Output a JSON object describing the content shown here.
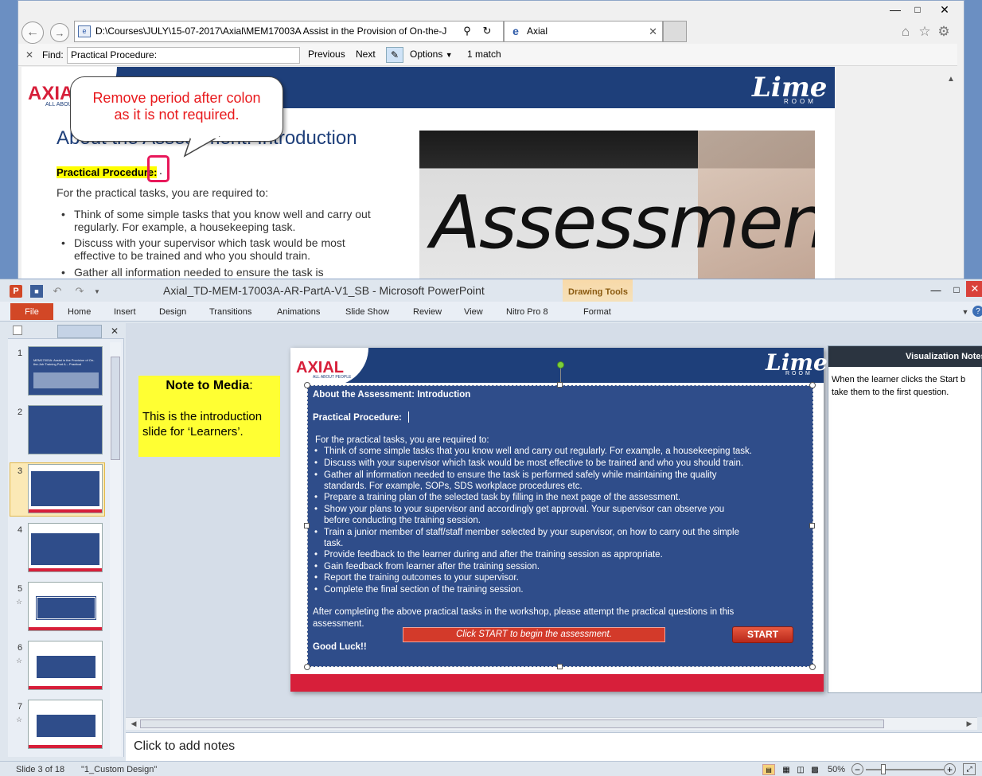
{
  "browser": {
    "address": "D:\\Courses\\JULY\\15-07-2017\\Axial\\MEM17003A Assist in the Provision of On-the-J",
    "tab_title": "Axial",
    "find_label": "Find:",
    "find_value": "Practical Procedure:",
    "previous": "Previous",
    "next": "Next",
    "options": "Options",
    "match_count": "1 match"
  },
  "web_page": {
    "logo": "AXIAL",
    "logo_sub": "ALL ABOUT",
    "brand": "Lime",
    "brand_sub": "ROOM",
    "heading": "About the Assessment: Introduction",
    "highlight": "Practical Procedure:",
    "period": ".",
    "intro": "For the practical tasks, you are required to:",
    "bullets": [
      "Think of some simple tasks that you know well and carry out regularly. For example, a housekeeping task.",
      "Discuss with your supervisor which task would be most effective to be trained and who you should train.",
      "Gather all information needed to ensure the task is"
    ],
    "image_text": "Assessment"
  },
  "callout": {
    "line1": "Remove period after colon",
    "line2": "as it is not required."
  },
  "ppt": {
    "title": "Axial_TD-MEM-17003A-AR-PartA-V1_SB  -  Microsoft PowerPoint",
    "context_tab_group": "Drawing Tools",
    "file_tab": "File",
    "tabs": [
      "Home",
      "Insert",
      "Design",
      "Transitions",
      "Animations",
      "Slide Show",
      "Review",
      "View",
      "Nitro Pro 8"
    ],
    "format_tab": "Format",
    "thumb_numbers": [
      "1",
      "2",
      "3",
      "4",
      "5",
      "6",
      "7"
    ],
    "thumb1_text": "MEM17003A: Assist in the Provision of On-the-Job Training Part A – Practical",
    "note_title": "Note to Media",
    "note_colon": ":",
    "note_body": "This is the introduction slide for ‘Learners’.",
    "notes_panel_title": "Visualization Notes",
    "notes_panel_body": "When the learner clicks the Start b take them to the first question.",
    "notes_placeholder": "Click to add notes",
    "status_slide": "Slide 3 of 18",
    "status_theme": "\"1_Custom Design\"",
    "zoom": "50%"
  },
  "slide": {
    "logo": "AXIAL",
    "logo_sub": "ALL ABOUT PEOPLE",
    "brand": "Lime",
    "brand_sub": "ROOM",
    "title": "About the Assessment: Introduction",
    "subtitle": "Practical Procedure:",
    "intro": "For the practical tasks, you are required to:",
    "bullets": [
      "Think of some simple tasks that you  know well and carry out regularly. For example, a housekeeping task.",
      "Discuss with your supervisor which task would be most effective to be trained and who you should train.",
      "Gather all information needed to ensure the task is performed safely while maintaining the quality",
      "Prepare a training plan of the selected task by filling in the next page of the assessment.",
      "Show your plans to your supervisor and accordingly get approval. Your supervisor can observe you",
      "Train a junior member of staff/staff member selected by your supervisor, on how to carry out the simple",
      "Provide feedback to the learner during and after the training session as appropriate.",
      "Gain feedback from learner after the training session.",
      "Report the training outcomes to your supervisor.",
      "Complete the final section of the training session."
    ],
    "cont": [
      "standards. For example, SOPs, SDS workplace procedures etc.",
      "before conducting the training session.",
      "task."
    ],
    "outro1": "After completing the above practical tasks in the workshop, please attempt the practical questions in this",
    "outro2": "assessment.",
    "good_luck": "Good Luck!!",
    "banner": "Click START to begin the assessment.",
    "start": "START"
  },
  "colors": {
    "slide_blue": "#2f4d8a",
    "brand_red": "#d71f3a",
    "note_yellow": "#ffff33",
    "callout_red": "#e8191c"
  }
}
